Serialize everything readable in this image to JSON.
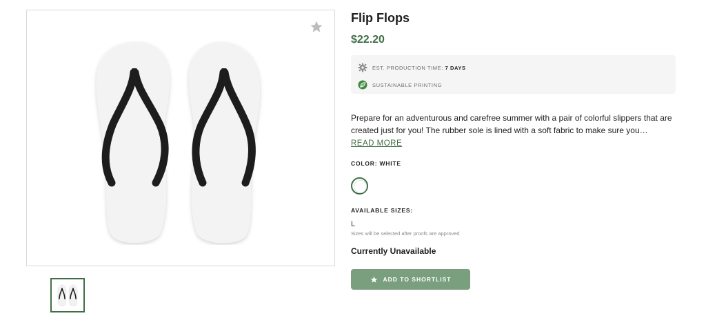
{
  "product": {
    "title": "Flip Flops",
    "price": "$22.20",
    "image_icon": "flip-flops-image",
    "favorite_icon": "star-icon"
  },
  "info": {
    "production_label": "Est. Production Time: ",
    "production_value": "7 Days",
    "sustainable_label": "Sustainable Printing"
  },
  "description": {
    "text": "Prepare for an adventurous and carefree summer with a pair of colorful slippers that are created just for you! The rubber sole is lined with a soft fabric to make sure you…",
    "read_more": "READ MORE"
  },
  "color": {
    "label": "COLOR: WHITE",
    "selected": "#ffffff"
  },
  "sizes": {
    "label": "AVAILABLE SIZES:",
    "value": "L",
    "note": "Sizes will be selected after proofs are approved"
  },
  "availability": "Currently Unavailable",
  "shortlist_button": {
    "label": "ADD TO SHORTLIST",
    "icon": "star-icon"
  },
  "colors": {
    "accent": "#3f6e45",
    "button": "#7a9f7e"
  }
}
